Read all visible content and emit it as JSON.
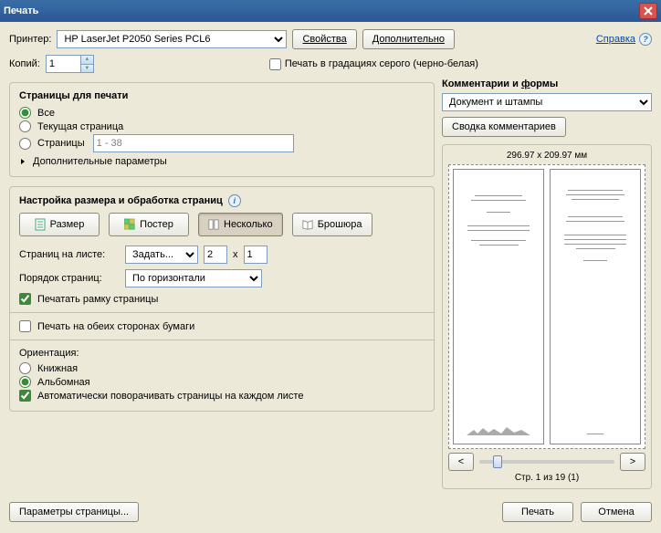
{
  "window": {
    "title": "Печать"
  },
  "top": {
    "printer_label": "Принтер:",
    "printer_value": "HP LaserJet P2050 Series PCL6",
    "properties_btn": "Свойства",
    "advanced_btn": "Дополнительно",
    "help_link": "Справка",
    "copies_label": "Копий:",
    "copies_value": "1",
    "grayscale_label": "Печать в градациях серого (черно-белая)"
  },
  "pages": {
    "title": "Страницы для печати",
    "all": "Все",
    "current": "Текущая страница",
    "range_label": "Страницы",
    "range_value": "1 - 38",
    "more": "Дополнительные параметры"
  },
  "sizing": {
    "title": "Настройка размера и обработка страниц",
    "size_btn": "Размер",
    "poster_btn": "Постер",
    "multiple_btn": "Несколько",
    "booklet_btn": "Брошюра",
    "pps_label": "Страниц на листе:",
    "pps_mode": "Задать...",
    "pps_x": "2",
    "pps_sep": "x",
    "pps_y": "1",
    "order_label": "Порядок страниц:",
    "order_value": "По горизонтали",
    "border_cb": "Печатать рамку страницы"
  },
  "duplex": {
    "both_sides": "Печать на обеих сторонах бумаги"
  },
  "orientation": {
    "label": "Ориентация:",
    "portrait": "Книжная",
    "landscape": "Альбомная",
    "auto_rotate": "Автоматически поворачивать страницы на каждом листе"
  },
  "comments": {
    "title": "Комментарии и формы",
    "value": "Документ и штампы",
    "summary_btn": "Сводка комментариев"
  },
  "preview": {
    "dims": "296.97 x 209.97 мм",
    "zoom_out": "<",
    "zoom_in": ">",
    "page_info": "Стр. 1 из 19 (1)"
  },
  "footer": {
    "page_setup": "Параметры страницы...",
    "print": "Печать",
    "cancel": "Отмена"
  },
  "chart_data": {
    "type": "table",
    "note": "dialog, not a chart"
  }
}
